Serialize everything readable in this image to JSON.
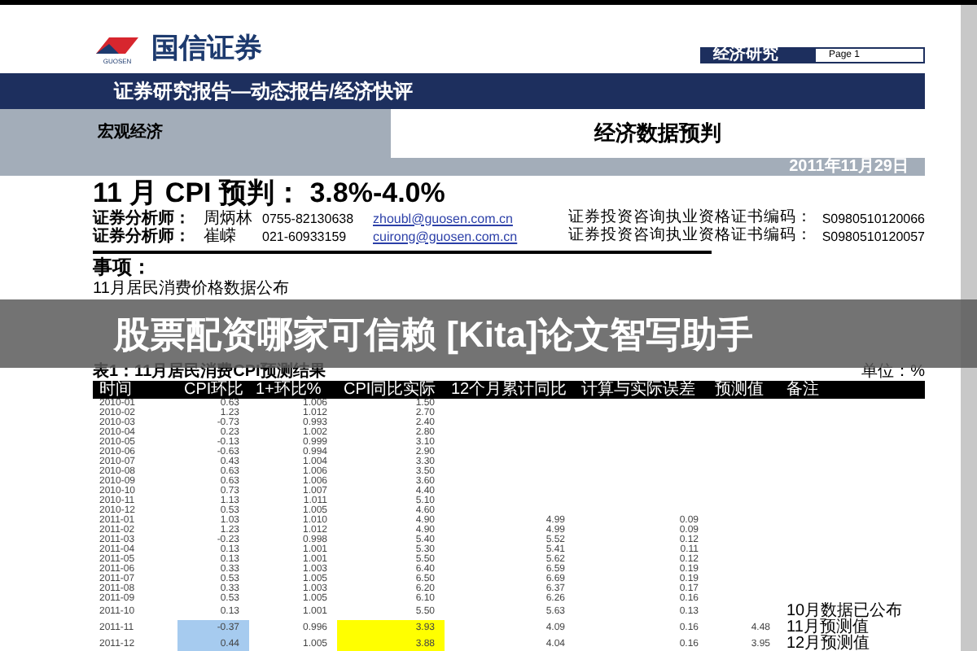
{
  "banner": "股票配资哪家可信赖 [Kita]论文智写助手",
  "header": {
    "logo_text": "国信证券",
    "logo_subtext": "GUOSEN",
    "section_label": "经济研究",
    "page": "Page 1"
  },
  "report_bar": "证券研究报告—动态报告/经济快评",
  "category": "宏观经济",
  "report_type": "经济数据预判",
  "date": "2011年11月29日",
  "title": "11 月 CPI 预判： 3.8%-4.0%",
  "analysts": [
    {
      "label": "证券分析师：",
      "name": "周炳林",
      "phone": "0755-82130638",
      "email": "zhoubl@guosen.com.cn",
      "cert_label": "证券投资咨询执业资格证书编码：",
      "cert": "S0980510120066"
    },
    {
      "label": "证券分析师：",
      "name": "崔嵘",
      "phone": "021-60933159",
      "email": "cuirong@guosen.com.cn",
      "cert_label": "证券投资咨询执业资格证书编码：",
      "cert": "S0980510120057"
    }
  ],
  "event_heading": "事项：",
  "event_text": "11月居民消费价格数据公布",
  "table": {
    "caption": "表1：11月居民消费CPI预测结果",
    "unit": "单位：%",
    "columns": [
      "时间",
      "CPI环比",
      "1+环比%",
      "CPI同比实际",
      "12个月累计同比",
      "计算与实际误差",
      "预测值",
      "备注"
    ],
    "rows": [
      [
        "2010-01",
        "0.63",
        "1.006",
        "1.50"
      ],
      [
        "2010-02",
        "1.23",
        "1.012",
        "2.70"
      ],
      [
        "2010-03",
        "-0.73",
        "0.993",
        "2.40"
      ],
      [
        "2010-04",
        "0.23",
        "1.002",
        "2.80"
      ],
      [
        "2010-05",
        "-0.13",
        "0.999",
        "3.10"
      ],
      [
        "2010-06",
        "-0.63",
        "0.994",
        "2.90"
      ],
      [
        "2010-07",
        "0.43",
        "1.004",
        "3.30"
      ],
      [
        "2010-08",
        "0.63",
        "1.006",
        "3.50"
      ],
      [
        "2010-09",
        "0.63",
        "1.006",
        "3.60"
      ],
      [
        "2010-10",
        "0.73",
        "1.007",
        "4.40"
      ],
      [
        "2010-11",
        "1.13",
        "1.011",
        "5.10"
      ],
      [
        "2010-12",
        "0.53",
        "1.005",
        "4.60"
      ],
      [
        "2011-01",
        "1.03",
        "1.010",
        "4.90",
        "4.99",
        "0.09"
      ],
      [
        "2011-02",
        "1.23",
        "1.012",
        "4.90",
        "4.99",
        "0.09"
      ],
      [
        "2011-03",
        "-0.23",
        "0.998",
        "5.40",
        "5.52",
        "0.12"
      ],
      [
        "2011-04",
        "0.13",
        "1.001",
        "5.30",
        "5.41",
        "0.11"
      ],
      [
        "2011-05",
        "0.13",
        "1.001",
        "5.50",
        "5.62",
        "0.12"
      ],
      [
        "2011-06",
        "0.33",
        "1.003",
        "6.40",
        "6.59",
        "0.19"
      ],
      [
        "2011-07",
        "0.53",
        "1.005",
        "6.50",
        "6.69",
        "0.19"
      ],
      [
        "2011-08",
        "0.33",
        "1.003",
        "6.20",
        "6.37",
        "0.17"
      ],
      [
        "2011-09",
        "0.53",
        "1.005",
        "6.10",
        "6.26",
        "0.16"
      ],
      [
        "2011-10",
        "0.13",
        "1.001",
        "5.50",
        "5.63",
        "0.13",
        "",
        "10月数据已公布"
      ],
      [
        "2011-11",
        {
          "text": "-0.37",
          "color": "#a6cbef"
        },
        "0.996",
        {
          "text": "3.93",
          "color": "#ffff00"
        },
        "4.09",
        "0.16",
        "4.48",
        "11月预测值"
      ],
      [
        "2011-12",
        {
          "text": "0.44",
          "color": "#a6cbef"
        },
        "1.005",
        {
          "text": "3.88",
          "color": "#ffff00"
        },
        "4.04",
        "0.16",
        "3.95",
        "12月预测值"
      ]
    ]
  }
}
